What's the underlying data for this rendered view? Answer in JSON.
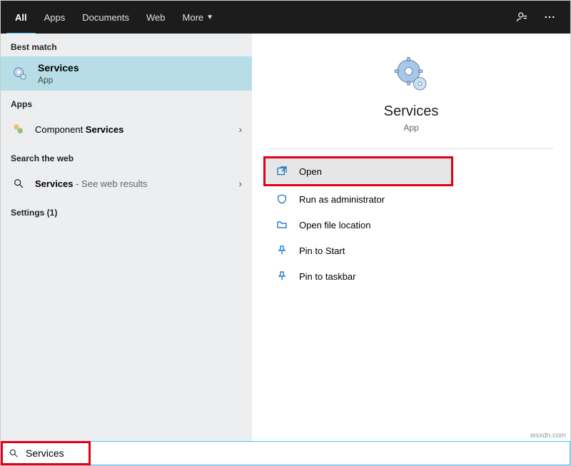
{
  "tabs": {
    "all": "All",
    "apps": "Apps",
    "documents": "Documents",
    "web": "Web",
    "more": "More"
  },
  "left": {
    "best_match_header": "Best match",
    "best_match": {
      "title": "Services",
      "subtitle": "App"
    },
    "apps_header": "Apps",
    "component_prefix": "Component ",
    "component_bold": "Services",
    "web_header": "Search the web",
    "web_item_bold": "Services",
    "web_item_suffix": " - See web results",
    "settings_header": "Settings (1)"
  },
  "right": {
    "title": "Services",
    "subtitle": "App",
    "actions": {
      "open": "Open",
      "run_admin": "Run as administrator",
      "open_loc": "Open file location",
      "pin_start": "Pin to Start",
      "pin_taskbar": "Pin to taskbar"
    }
  },
  "search": {
    "value": "Services"
  },
  "watermark": "wsxdn.com"
}
